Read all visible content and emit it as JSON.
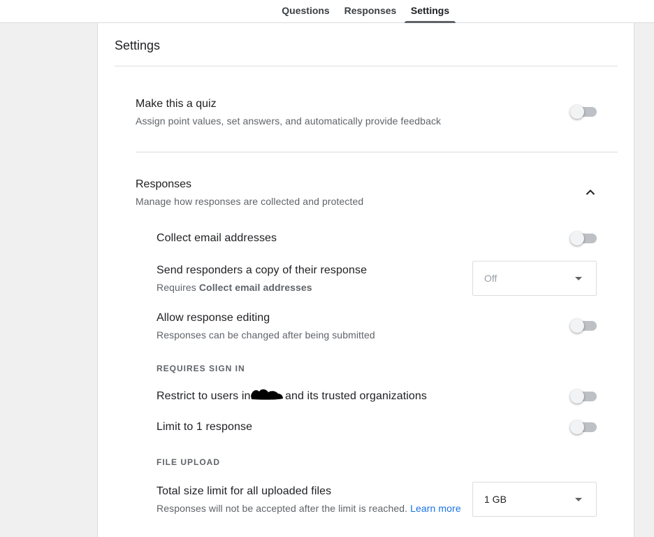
{
  "tabs": [
    {
      "label": "Questions"
    },
    {
      "label": "Responses"
    },
    {
      "label": "Settings"
    }
  ],
  "settings": {
    "title": "Settings",
    "quiz": {
      "title": "Make this a quiz",
      "subtitle": "Assign point values, set answers, and automatically provide feedback",
      "enabled": false
    },
    "responses": {
      "title": "Responses",
      "subtitle": "Manage how responses are collected and protected",
      "expanded": true,
      "collect_email": {
        "title": "Collect email addresses",
        "enabled": false
      },
      "send_copy": {
        "title": "Send responders a copy of their response",
        "requires_prefix": "Requires",
        "requires_bold": "Collect email addresses",
        "value": "Off"
      },
      "allow_editing": {
        "title": "Allow response editing",
        "subtitle": "Responses can be changed after being submitted",
        "enabled": false
      },
      "requires_sign_in_label": "REQUIRES SIGN IN",
      "restrict_users": {
        "title_start": "Restrict to users in",
        "title_end": "and its trusted organizations",
        "enabled": false
      },
      "limit_one": {
        "title": "Limit to 1 response",
        "enabled": false
      },
      "file_upload_label": "FILE UPLOAD",
      "size_limit": {
        "title": "Total size limit for all uploaded files",
        "subtitle": "Responses will not be accepted after the limit is reached.",
        "link": "Learn more",
        "value": "1 GB"
      }
    }
  },
  "colors": {
    "page_bg": "#f0f0f0",
    "card_bg": "#ffffff",
    "link": "#1a73e8",
    "toggle_off_track": "#bdc1c6"
  },
  "icons": {
    "collapse": "chevron-up-icon",
    "dropdown": "arrow-drop-down-icon"
  }
}
